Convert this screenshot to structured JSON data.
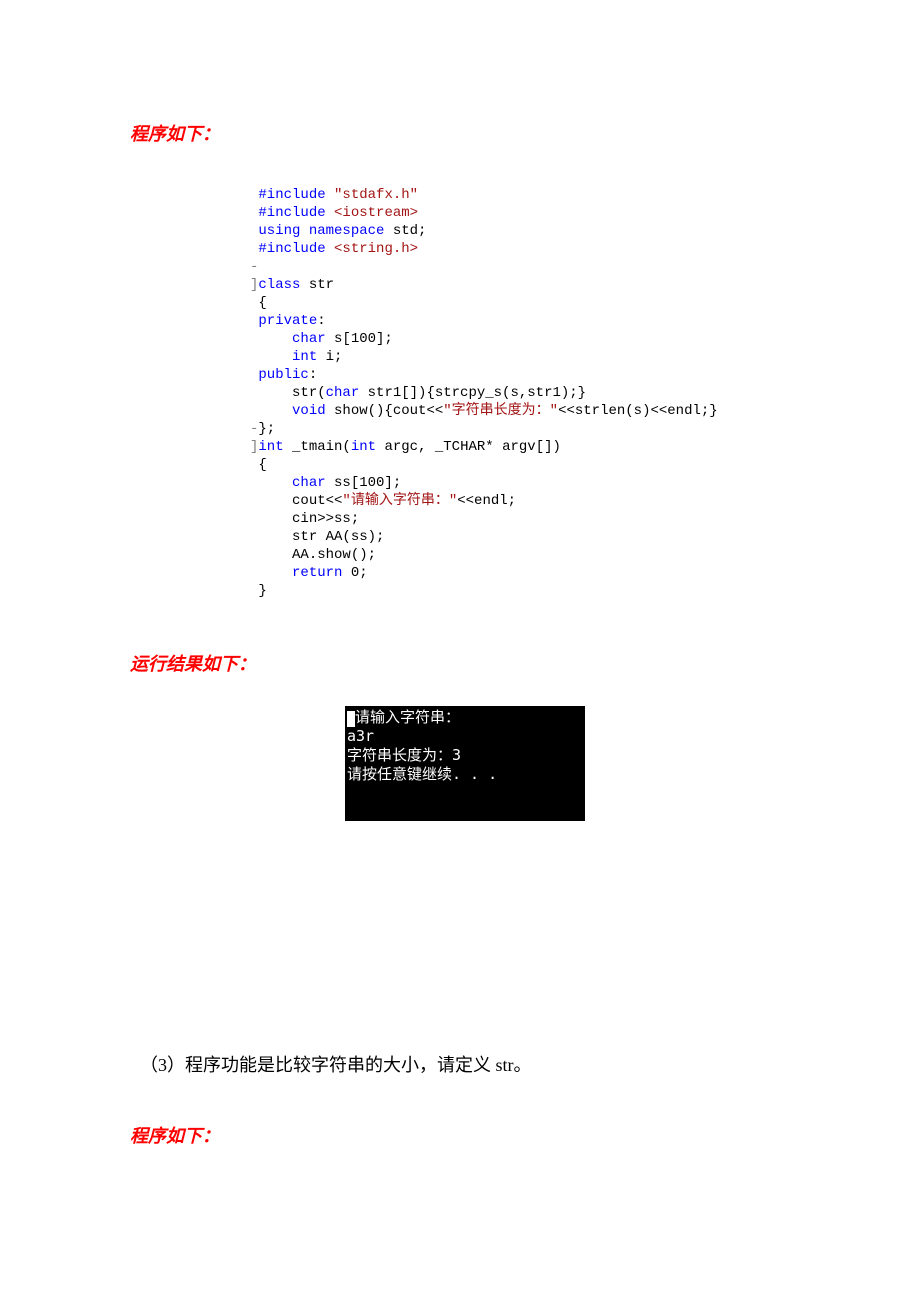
{
  "section1": {
    "heading": "程序如下：",
    "code": {
      "l1": {
        "a": "#include",
        "b": " ",
        "c": "\"stdafx.h\""
      },
      "l2": {
        "a": "#include",
        "b": " ",
        "c": "<iostream>"
      },
      "l3": {
        "a": "using",
        "b": " ",
        "c": "namespace",
        "d": " std;"
      },
      "l4": {
        "a": "#include",
        "b": " ",
        "c": "<string.h>"
      },
      "l5": "",
      "l6": {
        "a": "class",
        "b": " str"
      },
      "l7": "{",
      "l8": {
        "a": "private",
        "b": ":"
      },
      "l9": {
        "a": "    ",
        "b": "char",
        "c": " s[100];"
      },
      "l10": {
        "a": "    ",
        "b": "int",
        "c": " i;"
      },
      "l11": {
        "a": "public",
        "b": ":"
      },
      "l12": {
        "a": "    str(",
        "b": "char",
        "c": " str1[]){strcpy_s(s,str1);}"
      },
      "l13": {
        "a": "    ",
        "b": "void",
        "c": " show(){cout<<",
        "d": "\"字符串长度为：\"",
        "e": "<<strlen(s)<<endl;}"
      },
      "l14": "};",
      "l15": {
        "a": "int",
        "b": " _tmain(",
        "c": "int",
        "d": " argc, _TCHAR* argv[])"
      },
      "l16": "{",
      "l17": {
        "a": "    ",
        "b": "char",
        "c": " ss[100];"
      },
      "l18": {
        "a": "    cout<<",
        "b": "\"请输入字符串：\"",
        "c": "<<endl;"
      },
      "l19": "    cin>>ss;",
      "l20": "    str AA(ss);",
      "l21": "    AA.show();",
      "l22": {
        "a": "    ",
        "b": "return",
        "c": " 0;"
      },
      "l23": "}"
    }
  },
  "section2": {
    "heading": "运行结果如下：",
    "console": {
      "l1": "请输入字符串：",
      "l2": "a3r",
      "l3": "字符串长度为：3",
      "l4": "请按任意键继续. . ."
    }
  },
  "section3": {
    "text": "（3）程序功能是比较字符串的大小，请定义 str。",
    "heading": "程序如下："
  }
}
